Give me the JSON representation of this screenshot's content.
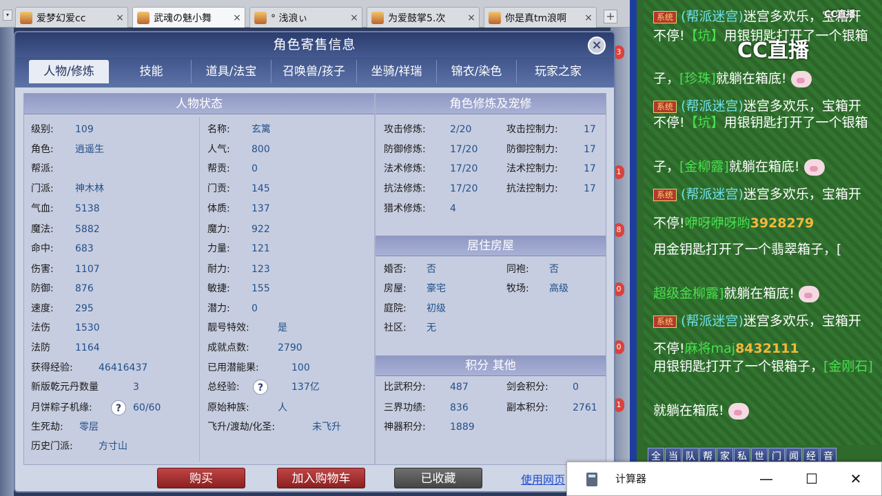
{
  "browser_tabs": [
    {
      "title": "爱梦幻爱cc",
      "close": "×"
    },
    {
      "title": "武魂の魅小舞",
      "close": "×"
    },
    {
      "title": "° 浅浪ぃ",
      "close": "×"
    },
    {
      "title": "为爱鼓掌5.次",
      "close": "×"
    },
    {
      "title": "你是真tm浪啊",
      "close": "×"
    }
  ],
  "tab_add": "+",
  "tab_menu": "▾",
  "panel": {
    "title": "角色寄售信息",
    "close": "×",
    "tabs": [
      "人物/修炼",
      "技能",
      "道具/法宝",
      "召唤兽/孩子",
      "坐骑/祥瑞",
      "锦衣/染色",
      "玩家之家"
    ],
    "active_tab": 0
  },
  "status": {
    "header": "人物状态",
    "left": [
      {
        "label": "级别:",
        "value": "109"
      },
      {
        "label": "角色:",
        "value": "逍遥生"
      },
      {
        "label": "帮派:",
        "value": ""
      },
      {
        "label": "门派:",
        "value": "神木林"
      },
      {
        "label": "气血:",
        "value": "5138"
      },
      {
        "label": "魔法:",
        "value": "5882"
      },
      {
        "label": "命中:",
        "value": "683"
      },
      {
        "label": "伤害:",
        "value": "1107"
      },
      {
        "label": "防御:",
        "value": "876"
      },
      {
        "label": "速度:",
        "value": "295"
      },
      {
        "label": "法伤",
        "value": "1530"
      },
      {
        "label": "法防",
        "value": "1164"
      },
      {
        "label": "获得经验:",
        "value": "46416437"
      },
      {
        "label": "新版乾元丹数量",
        "value": "3"
      },
      {
        "label": "月饼粽子机缘:",
        "value": "60/60"
      },
      {
        "label": "生死劫:",
        "value": "零层"
      },
      {
        "label": "历史门派:",
        "value": "方寸山"
      }
    ],
    "right": [
      {
        "label": "名称:",
        "value": "玄篱"
      },
      {
        "label": "人气:",
        "value": "800"
      },
      {
        "label": "帮贡:",
        "value": "0"
      },
      {
        "label": "门贡:",
        "value": "145"
      },
      {
        "label": "体质:",
        "value": "137"
      },
      {
        "label": "魔力:",
        "value": "922"
      },
      {
        "label": "力量:",
        "value": "121"
      },
      {
        "label": "耐力:",
        "value": "123"
      },
      {
        "label": "敏捷:",
        "value": "155"
      },
      {
        "label": "潜力:",
        "value": "0"
      },
      {
        "label": "靓号特效:",
        "value": "是"
      },
      {
        "label": "成就点数:",
        "value": "2790"
      },
      {
        "label": "已用潜能果:",
        "value": "100"
      },
      {
        "label": "总经验:",
        "value": "137亿"
      },
      {
        "label": "原始种族:",
        "value": "人"
      },
      {
        "label": "飞升/渡劫/化圣:",
        "value": "未飞升"
      }
    ],
    "help_mark": "?"
  },
  "cultivation": {
    "header": "角色修炼及宠修",
    "left": [
      {
        "label": "攻击修炼:",
        "value": "2/20"
      },
      {
        "label": "防御修炼:",
        "value": "17/20"
      },
      {
        "label": "法术修炼:",
        "value": "17/20"
      },
      {
        "label": "抗法修炼:",
        "value": "17/20"
      },
      {
        "label": "猎术修炼:",
        "value": "4"
      }
    ],
    "right": [
      {
        "label": "攻击控制力:",
        "value": "17"
      },
      {
        "label": "防御控制力:",
        "value": "17"
      },
      {
        "label": "法术控制力:",
        "value": "17"
      },
      {
        "label": "抗法控制力:",
        "value": "17"
      }
    ]
  },
  "housing": {
    "header": "居住房屋",
    "left": [
      {
        "label": "婚否:",
        "value": "否"
      },
      {
        "label": "房屋:",
        "value": "豪宅"
      },
      {
        "label": "庭院:",
        "value": "初级"
      },
      {
        "label": "社区:",
        "value": "无"
      }
    ],
    "right": [
      {
        "label": "同袍:",
        "value": "否"
      },
      {
        "label": "牧场:",
        "value": "高级"
      }
    ]
  },
  "points": {
    "header": "积分 其他",
    "left": [
      {
        "label": "比武积分:",
        "value": "487"
      },
      {
        "label": "三界功绩:",
        "value": "836"
      },
      {
        "label": "神器积分:",
        "value": "1889"
      }
    ],
    "right": [
      {
        "label": "剑会积分:",
        "value": "0"
      },
      {
        "label": "副本积分:",
        "value": "2761"
      }
    ]
  },
  "buttons": {
    "buy": "购买",
    "add_cart": "加入购物车",
    "favorited": "已收藏",
    "web_link": "使用网页"
  },
  "chat": {
    "system_tag": "系统",
    "lines": [
      {
        "tag": "(帮派迷宫)",
        "a": "迷宫多欢乐，宝箱开",
        "b": "不停!",
        "who": "【坑】",
        "c": "用银钥匙打开了一个银箱",
        "d": "子，",
        "item": "[珍珠]",
        "e": "就躺在箱底!"
      },
      {
        "tag": "(帮派迷宫)",
        "a": "迷宫多欢乐，宝箱开",
        "b": "不停!",
        "who": "【坑】",
        "c": "用银钥匙打开了一个银箱",
        "d": "子，",
        "item": "[金柳露]",
        "e": "就躺在箱底!"
      },
      {
        "tag": "(帮派迷宫)",
        "a": "迷宫多欢乐，宝箱开",
        "b": "不停!",
        "who": "咿呀咿呀哟",
        "id": "3928279",
        "c": "用金钥匙打开了一个翡翠箱子，[",
        "item": "超级金柳露]",
        "e": "就躺在箱底!"
      },
      {
        "tag": "(帮派迷宫)",
        "a": "迷宫多欢乐，宝箱开",
        "b": "不停!",
        "who": "麻将maj",
        "id": "8432111",
        "c": "用银钥匙打开了一个银箱子，",
        "item": "[金刚石]",
        "e": "就躺在箱底!"
      }
    ],
    "buttons": [
      "全",
      "当",
      "队",
      "帮",
      "家",
      "私",
      "世",
      "门",
      "闻",
      "经",
      "音"
    ],
    "logo": "CC直播",
    "logo_small": "CC直播"
  },
  "calculator": {
    "title": "计算器",
    "min": "—",
    "max": "☐",
    "close": "✕"
  },
  "side_badges": [
    "3",
    "1",
    "8",
    "0",
    "0",
    "1"
  ]
}
